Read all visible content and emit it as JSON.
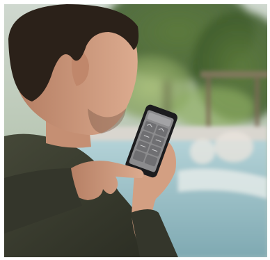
{
  "scene": {
    "kind": "photograph",
    "subject": "man-using-smartphone-app",
    "colors": {
      "sky": "#dfe6e4",
      "foliage_dark": "#3d5a2a",
      "foliage_mid": "#6f8f4a",
      "foliage_light": "#a9bf7c",
      "pool_water": "#9fc3cc",
      "pool_deck": "#d9d6cf",
      "hair": "#2b2119",
      "skin": "#d6a386",
      "skin_shadow": "#b47d62",
      "sweater": "#3b3d30",
      "sweater_dark": "#2a2c22",
      "phone_body": "#1c1c1e",
      "phone_screen": "#8b8b8d",
      "app_tile": "#6f6f72"
    },
    "phone_app": {
      "tile_icons": [
        "wave-icon",
        "gauge-icon",
        "thermometer-icon",
        "fan-icon",
        "light-icon",
        "pump-icon",
        "gear-icon",
        "timer-icon"
      ]
    }
  }
}
